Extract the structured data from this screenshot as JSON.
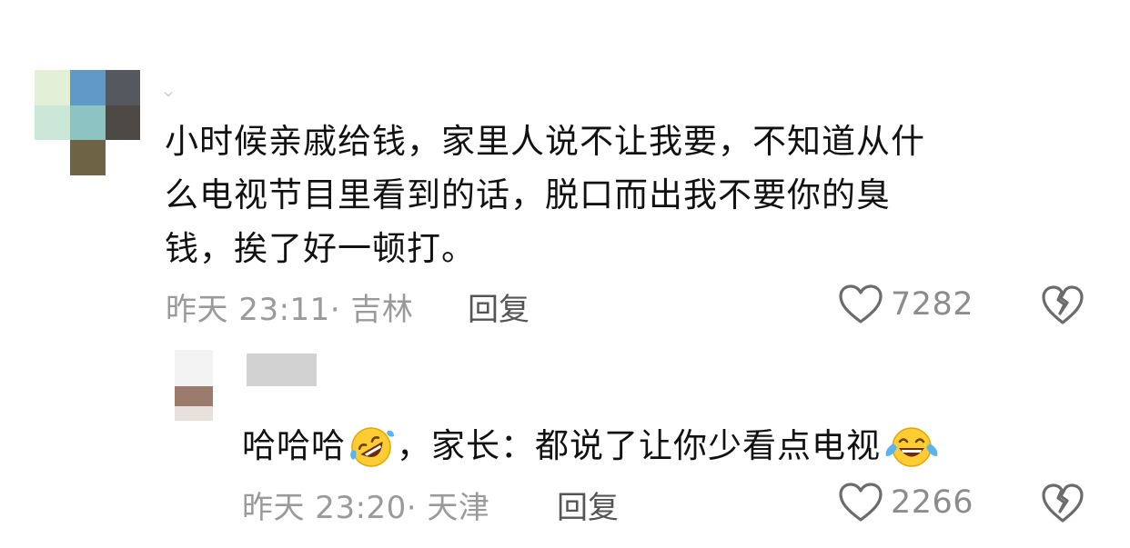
{
  "comment": {
    "text_lines": [
      "小时候亲戚给钱，家里人说不让我要，不知道从什",
      "么电视节目里看到的话，脱口而出我不要你的臭",
      "钱，挨了好一顿打。"
    ],
    "time": "昨天 23:11",
    "location": "吉林",
    "reply_label": "回复",
    "like_count": "7282",
    "avatar_colors": [
      "#e4efd8",
      "#5f9ac6",
      "#55585e",
      "#cbe7d8",
      "#8dc3c2",
      "#4e4944",
      "#6e6344"
    ]
  },
  "reply": {
    "text_part1": "哈哈哈",
    "text_part2": "，家长：都说了让你少看点电视",
    "emoji_1": "rofl-emoji",
    "emoji_2": "tears-of-joy-emoji",
    "time": "昨天 23:20",
    "location": "天津",
    "reply_label": "回复",
    "like_count": "2266",
    "avatar_colors": [
      "#f3f3f3",
      "#9b7b6c",
      "#e8e0dc"
    ]
  },
  "colors": {
    "text": "#111111",
    "meta": "#9a9a9a",
    "icon": "#6b6b6b"
  }
}
